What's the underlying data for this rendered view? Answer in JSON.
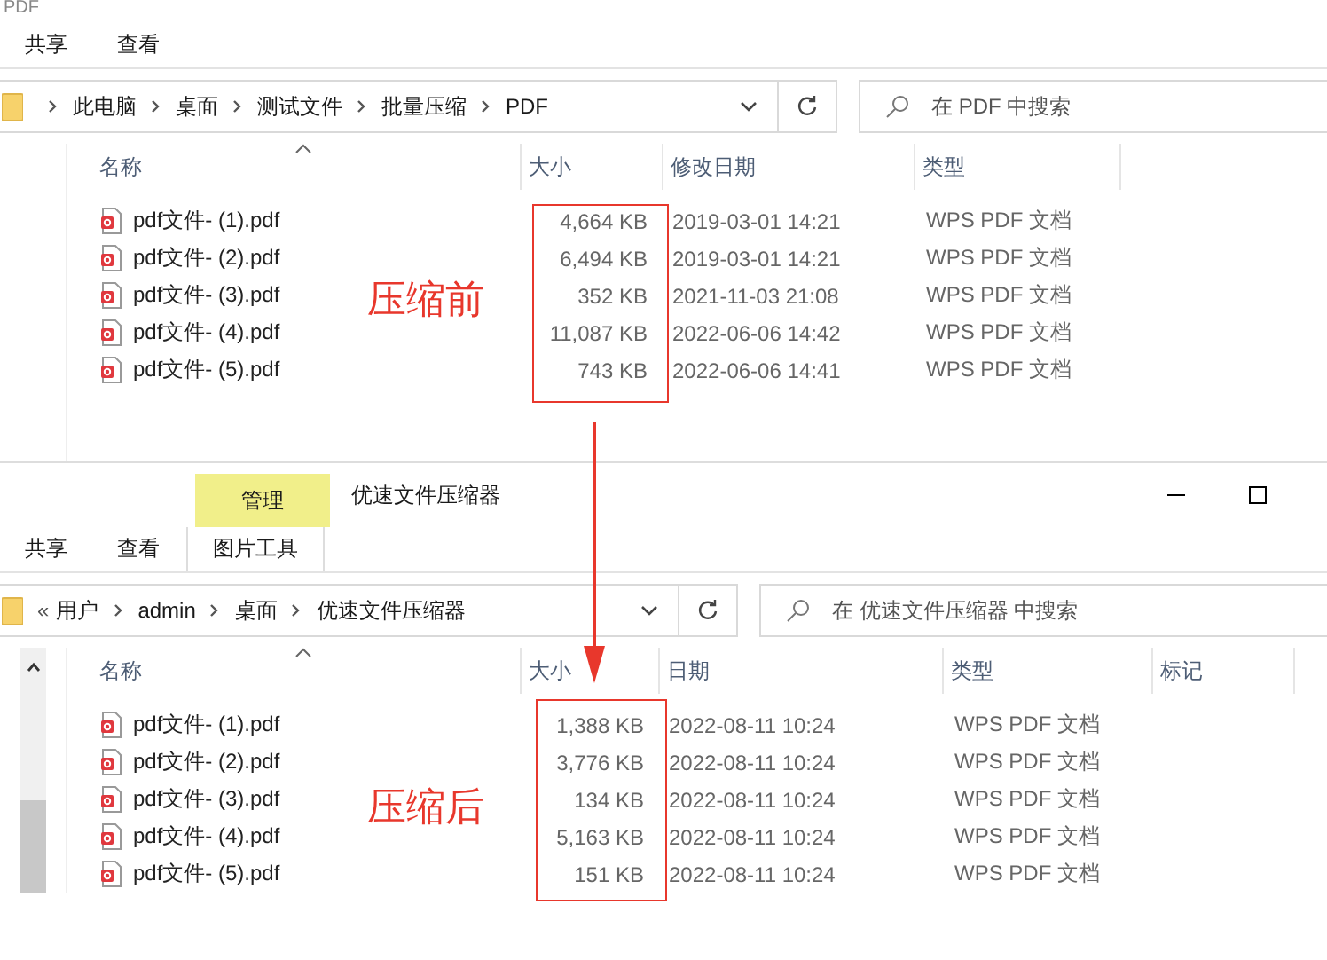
{
  "top_window": {
    "title": "PDF",
    "ribbon_tabs": [
      "共享",
      "查看"
    ],
    "breadcrumb": [
      "此电脑",
      "桌面",
      "测试文件",
      "批量压缩",
      "PDF"
    ],
    "search": {
      "placeholder": "在 PDF 中搜索"
    },
    "columns": [
      "名称",
      "大小",
      "修改日期",
      "类型"
    ],
    "rows": [
      {
        "name": "pdf文件- (1).pdf",
        "size": "4,664 KB",
        "date": "2019-03-01 14:21",
        "type": "WPS PDF 文档"
      },
      {
        "name": "pdf文件- (2).pdf",
        "size": "6,494 KB",
        "date": "2019-03-01 14:21",
        "type": "WPS PDF 文档"
      },
      {
        "name": "pdf文件- (3).pdf",
        "size": "352 KB",
        "date": "2021-11-03 21:08",
        "type": "WPS PDF 文档"
      },
      {
        "name": "pdf文件- (4).pdf",
        "size": "11,087 KB",
        "date": "2022-06-06 14:42",
        "type": "WPS PDF 文档"
      },
      {
        "name": "pdf文件- (5).pdf",
        "size": "743 KB",
        "date": "2022-06-06 14:41",
        "type": "WPS PDF 文档"
      }
    ]
  },
  "bottom_window": {
    "title": "优速文件压缩器",
    "context_group": "管理",
    "ribbon_tabs": [
      {
        "label": "共享",
        "kind": "plain"
      },
      {
        "label": "查看",
        "kind": "plain"
      },
      {
        "label": "图片工具",
        "kind": "context"
      }
    ],
    "breadcrumb_overflow": "«",
    "breadcrumb": [
      "用户",
      "admin",
      "桌面",
      "优速文件压缩器"
    ],
    "search": {
      "placeholder": "在 优速文件压缩器 中搜索"
    },
    "columns": [
      "名称",
      "大小",
      "日期",
      "类型",
      "标记"
    ],
    "rows": [
      {
        "name": "pdf文件- (1).pdf",
        "size": "1,388 KB",
        "date": "2022-08-11 10:24",
        "type": "WPS PDF 文档"
      },
      {
        "name": "pdf文件- (2).pdf",
        "size": "3,776 KB",
        "date": "2022-08-11 10:24",
        "type": "WPS PDF 文档"
      },
      {
        "name": "pdf文件- (3).pdf",
        "size": "134 KB",
        "date": "2022-08-11 10:24",
        "type": "WPS PDF 文档"
      },
      {
        "name": "pdf文件- (4).pdf",
        "size": "5,163 KB",
        "date": "2022-08-11 10:24",
        "type": "WPS PDF 文档"
      },
      {
        "name": "pdf文件- (5).pdf",
        "size": "151 KB",
        "date": "2022-08-11 10:24",
        "type": "WPS PDF 文档"
      }
    ]
  },
  "annotations": [
    "压缩前",
    "压缩后"
  ]
}
